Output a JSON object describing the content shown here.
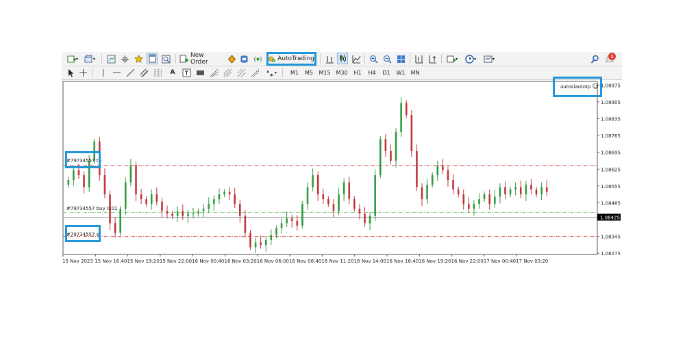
{
  "toolbar": {
    "new_order_label": "New Order",
    "autotrading_label": "AutoTrading",
    "notification_count": "1",
    "timeframes": [
      "M1",
      "M5",
      "M15",
      "M30",
      "H1",
      "H4",
      "D1",
      "W1",
      "MN"
    ]
  },
  "chart": {
    "tp_label": "#79734557 tp",
    "buy_label": "#79734557 buy 0.01",
    "sl_label": "#79734557 sl",
    "ea_label": "autoslautotp",
    "ea_smiley": "☺",
    "current_price_label": "1.08425"
  },
  "chart_data": {
    "type": "candlestick",
    "y_ticks": [
      "1.08975",
      "1.08905",
      "1.08835",
      "1.08765",
      "1.08695",
      "1.08625",
      "1.08555",
      "1.08485",
      "1.08345",
      "1.08275"
    ],
    "ylim": [
      1.0827,
      1.0899
    ],
    "x_ticks": [
      "15 Nov 2023",
      "15 Nov 16:40",
      "15 Nov 19:20",
      "15 Nov 22:00",
      "16 Nov 00:40",
      "16 Nov 03:20",
      "16 Nov 06:00",
      "16 Nov 08:40",
      "16 Nov 11:20",
      "16 Nov 14:00",
      "16 Nov 16:40",
      "16 Nov 19:20",
      "16 Nov 22:00",
      "17 Nov 00:40",
      "17 Nov 03:20"
    ],
    "levels": {
      "take_profit": 1.0864,
      "open": 1.08445,
      "stop_loss": 1.08345,
      "bid": 1.08425
    },
    "closes": [
      1.0858,
      1.0862,
      1.086,
      1.0855,
      1.0866,
      1.0874,
      1.086,
      1.0852,
      1.084,
      1.0836,
      1.0846,
      1.0857,
      1.0864,
      1.0852,
      1.085,
      1.0848,
      1.0852,
      1.0849,
      1.0845,
      1.0844,
      1.0843,
      1.0845,
      1.0843,
      1.0844,
      1.0844,
      1.0845,
      1.0846,
      1.0848,
      1.085,
      1.0852,
      1.0853,
      1.0852,
      1.0848,
      1.0843,
      1.0836,
      1.083,
      1.0832,
      1.0831,
      1.0833,
      1.0835,
      1.0838,
      1.084,
      1.0842,
      1.0841,
      1.0839,
      1.0848,
      1.0855,
      1.086,
      1.0852,
      1.085,
      1.0848,
      1.0845,
      1.0852,
      1.0857,
      1.085,
      1.0846,
      1.0844,
      1.084,
      1.0843,
      1.086,
      1.0875,
      1.087,
      1.0866,
      1.0878,
      1.089,
      1.0885,
      1.087,
      1.0855,
      1.085,
      1.0856,
      1.086,
      1.0864,
      1.0862,
      1.0858,
      1.0854,
      1.0852,
      1.0848,
      1.0846,
      1.0848,
      1.085,
      1.0852,
      1.0848,
      1.0851,
      1.0855,
      1.0852,
      1.0854,
      1.0855,
      1.0852,
      1.0856,
      1.0854,
      1.0852,
      1.0855,
      1.0853
    ]
  }
}
